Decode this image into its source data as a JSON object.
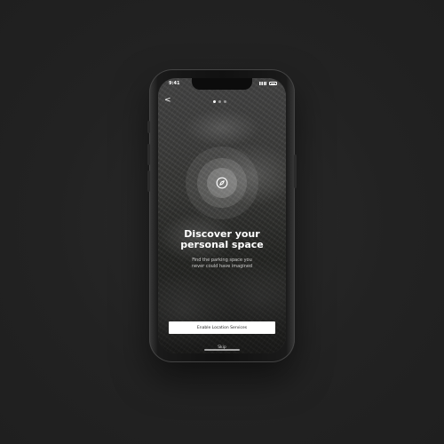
{
  "device": {
    "status_bar": {
      "time": "9:41"
    }
  },
  "onboarding": {
    "back_glyph": "<",
    "pagination": {
      "total": 3,
      "active_index": 0
    },
    "icon": "compass-icon",
    "title_line1": "Discover your",
    "title_line2": "personal space",
    "subtitle_line1": "Find the parking space you",
    "subtitle_line2": "never could have imagined",
    "primary_button_label": "Enable Location Services",
    "secondary_link_label": "Skip"
  },
  "colors": {
    "background": "#222222",
    "button_bg": "#ffffff",
    "text_primary": "#ffffff"
  }
}
